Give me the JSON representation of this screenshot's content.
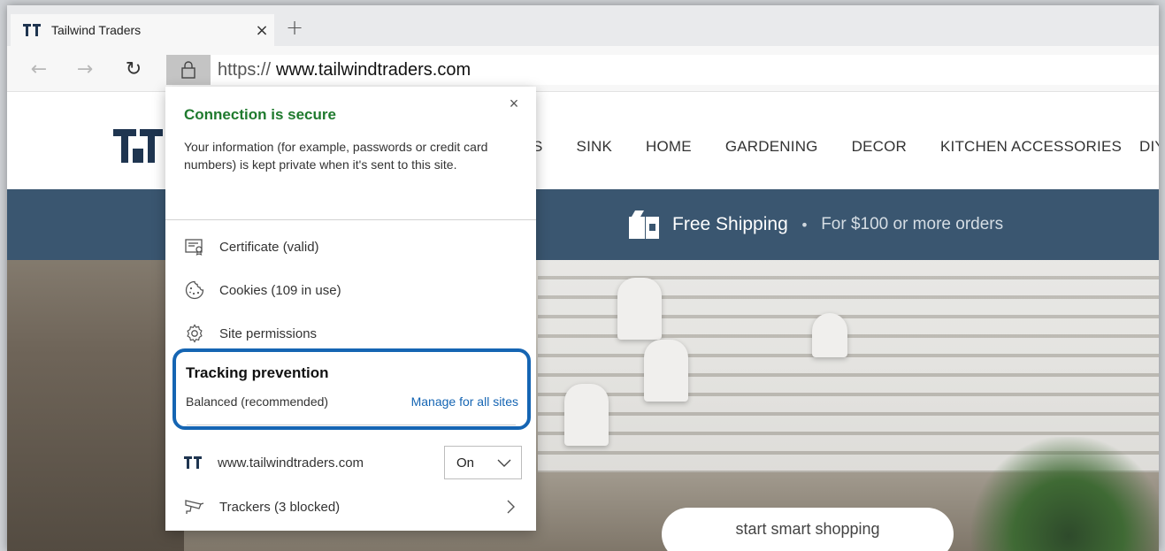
{
  "browser": {
    "tab": {
      "title": "Tailwind Traders",
      "close": "×"
    },
    "new_tab": "+",
    "nav": {
      "back": "←",
      "forward": "→",
      "refresh": "↻"
    },
    "address": {
      "scheme": "https://",
      "host": "www.tailwindtraders.com"
    }
  },
  "site": {
    "menu": [
      "S",
      "SINK",
      "HOME",
      "GARDENING",
      "DECOR",
      "KITCHEN ACCESSORIES"
    ],
    "menu_overflow": "DIY",
    "shipping": {
      "title": "Free Shipping",
      "separator": "•",
      "subtitle": "For $100 or more orders"
    },
    "cta": "start smart shopping"
  },
  "popup": {
    "close": "×",
    "title": "Connection is secure",
    "description": "Your information (for example, passwords or credit card numbers) is kept private when it's sent to this site.",
    "items": [
      {
        "label": "Certificate (valid)",
        "icon": "certificate-icon"
      },
      {
        "label": "Cookies (109 in use)",
        "icon": "cookie-icon"
      },
      {
        "label": "Site permissions",
        "icon": "gear-icon"
      }
    ],
    "tracking": {
      "title": "Tracking prevention",
      "mode": "Balanced (recommended)",
      "manage_link": "Manage for all sites"
    },
    "site_toggle": {
      "site": "www.tailwindtraders.com",
      "value": "On"
    },
    "trackers": {
      "label": "Trackers (3 blocked)"
    }
  },
  "colors": {
    "secure_green": "#1f7a2e",
    "highlight_blue": "#1565b3",
    "shipping_bar": "#3a5670"
  }
}
